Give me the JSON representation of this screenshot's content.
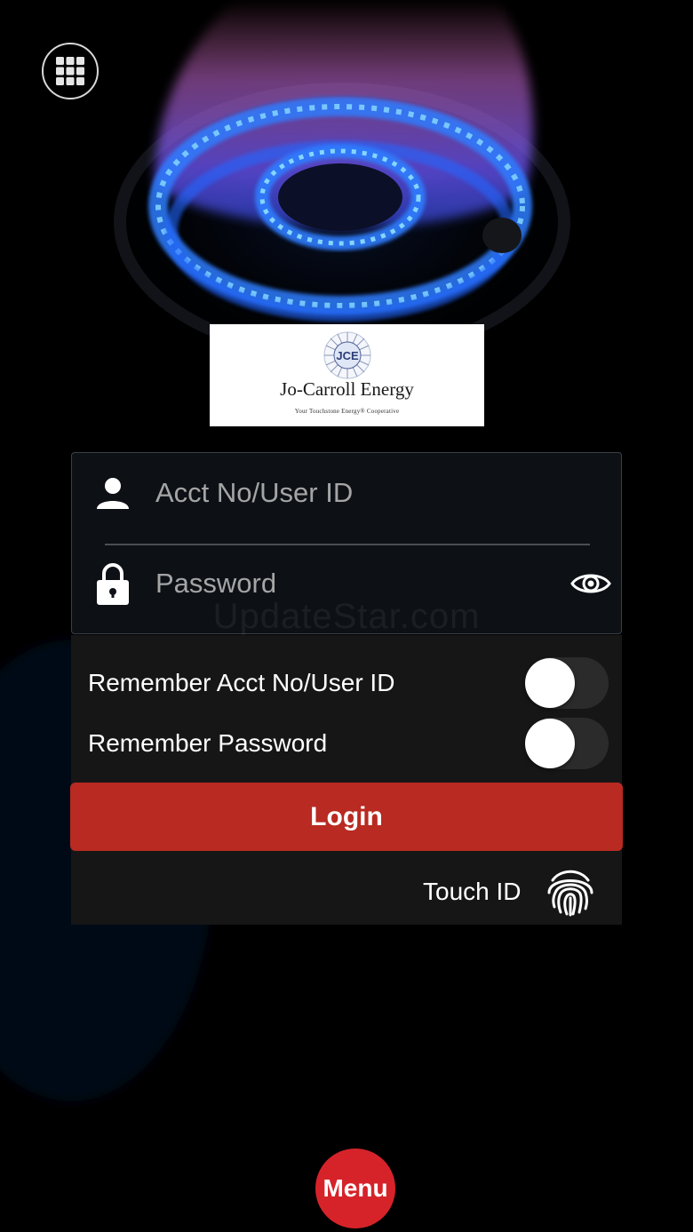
{
  "background": {
    "description_icon": "gas-burner-flame-image"
  },
  "grid_button": {
    "icon": "grid-icon"
  },
  "logo": {
    "monogram": "JCE",
    "name": "Jo-Carroll Energy",
    "tagline": "Your Touchstone Energy® Cooperative"
  },
  "login_form": {
    "username_placeholder": "Acct No/User ID",
    "username_value": "",
    "password_placeholder": "Password",
    "password_value": "",
    "user_icon": "user-icon",
    "lock_icon": "lock-icon",
    "eye_icon": "eye-icon"
  },
  "watermark": "UpdateStar.com",
  "options": {
    "remember_user_label": "Remember Acct No/User ID",
    "remember_user_on": false,
    "remember_password_label": "Remember Password",
    "remember_password_on": false
  },
  "login_button_label": "Login",
  "touch_id": {
    "label": "Touch ID",
    "icon": "fingerprint-icon"
  },
  "menu_button_label": "Menu",
  "colors": {
    "login_button": "#b82a22",
    "menu_button": "#d6232a",
    "flame_blue": "#2f7dff",
    "flame_purple": "#8a52ff"
  }
}
